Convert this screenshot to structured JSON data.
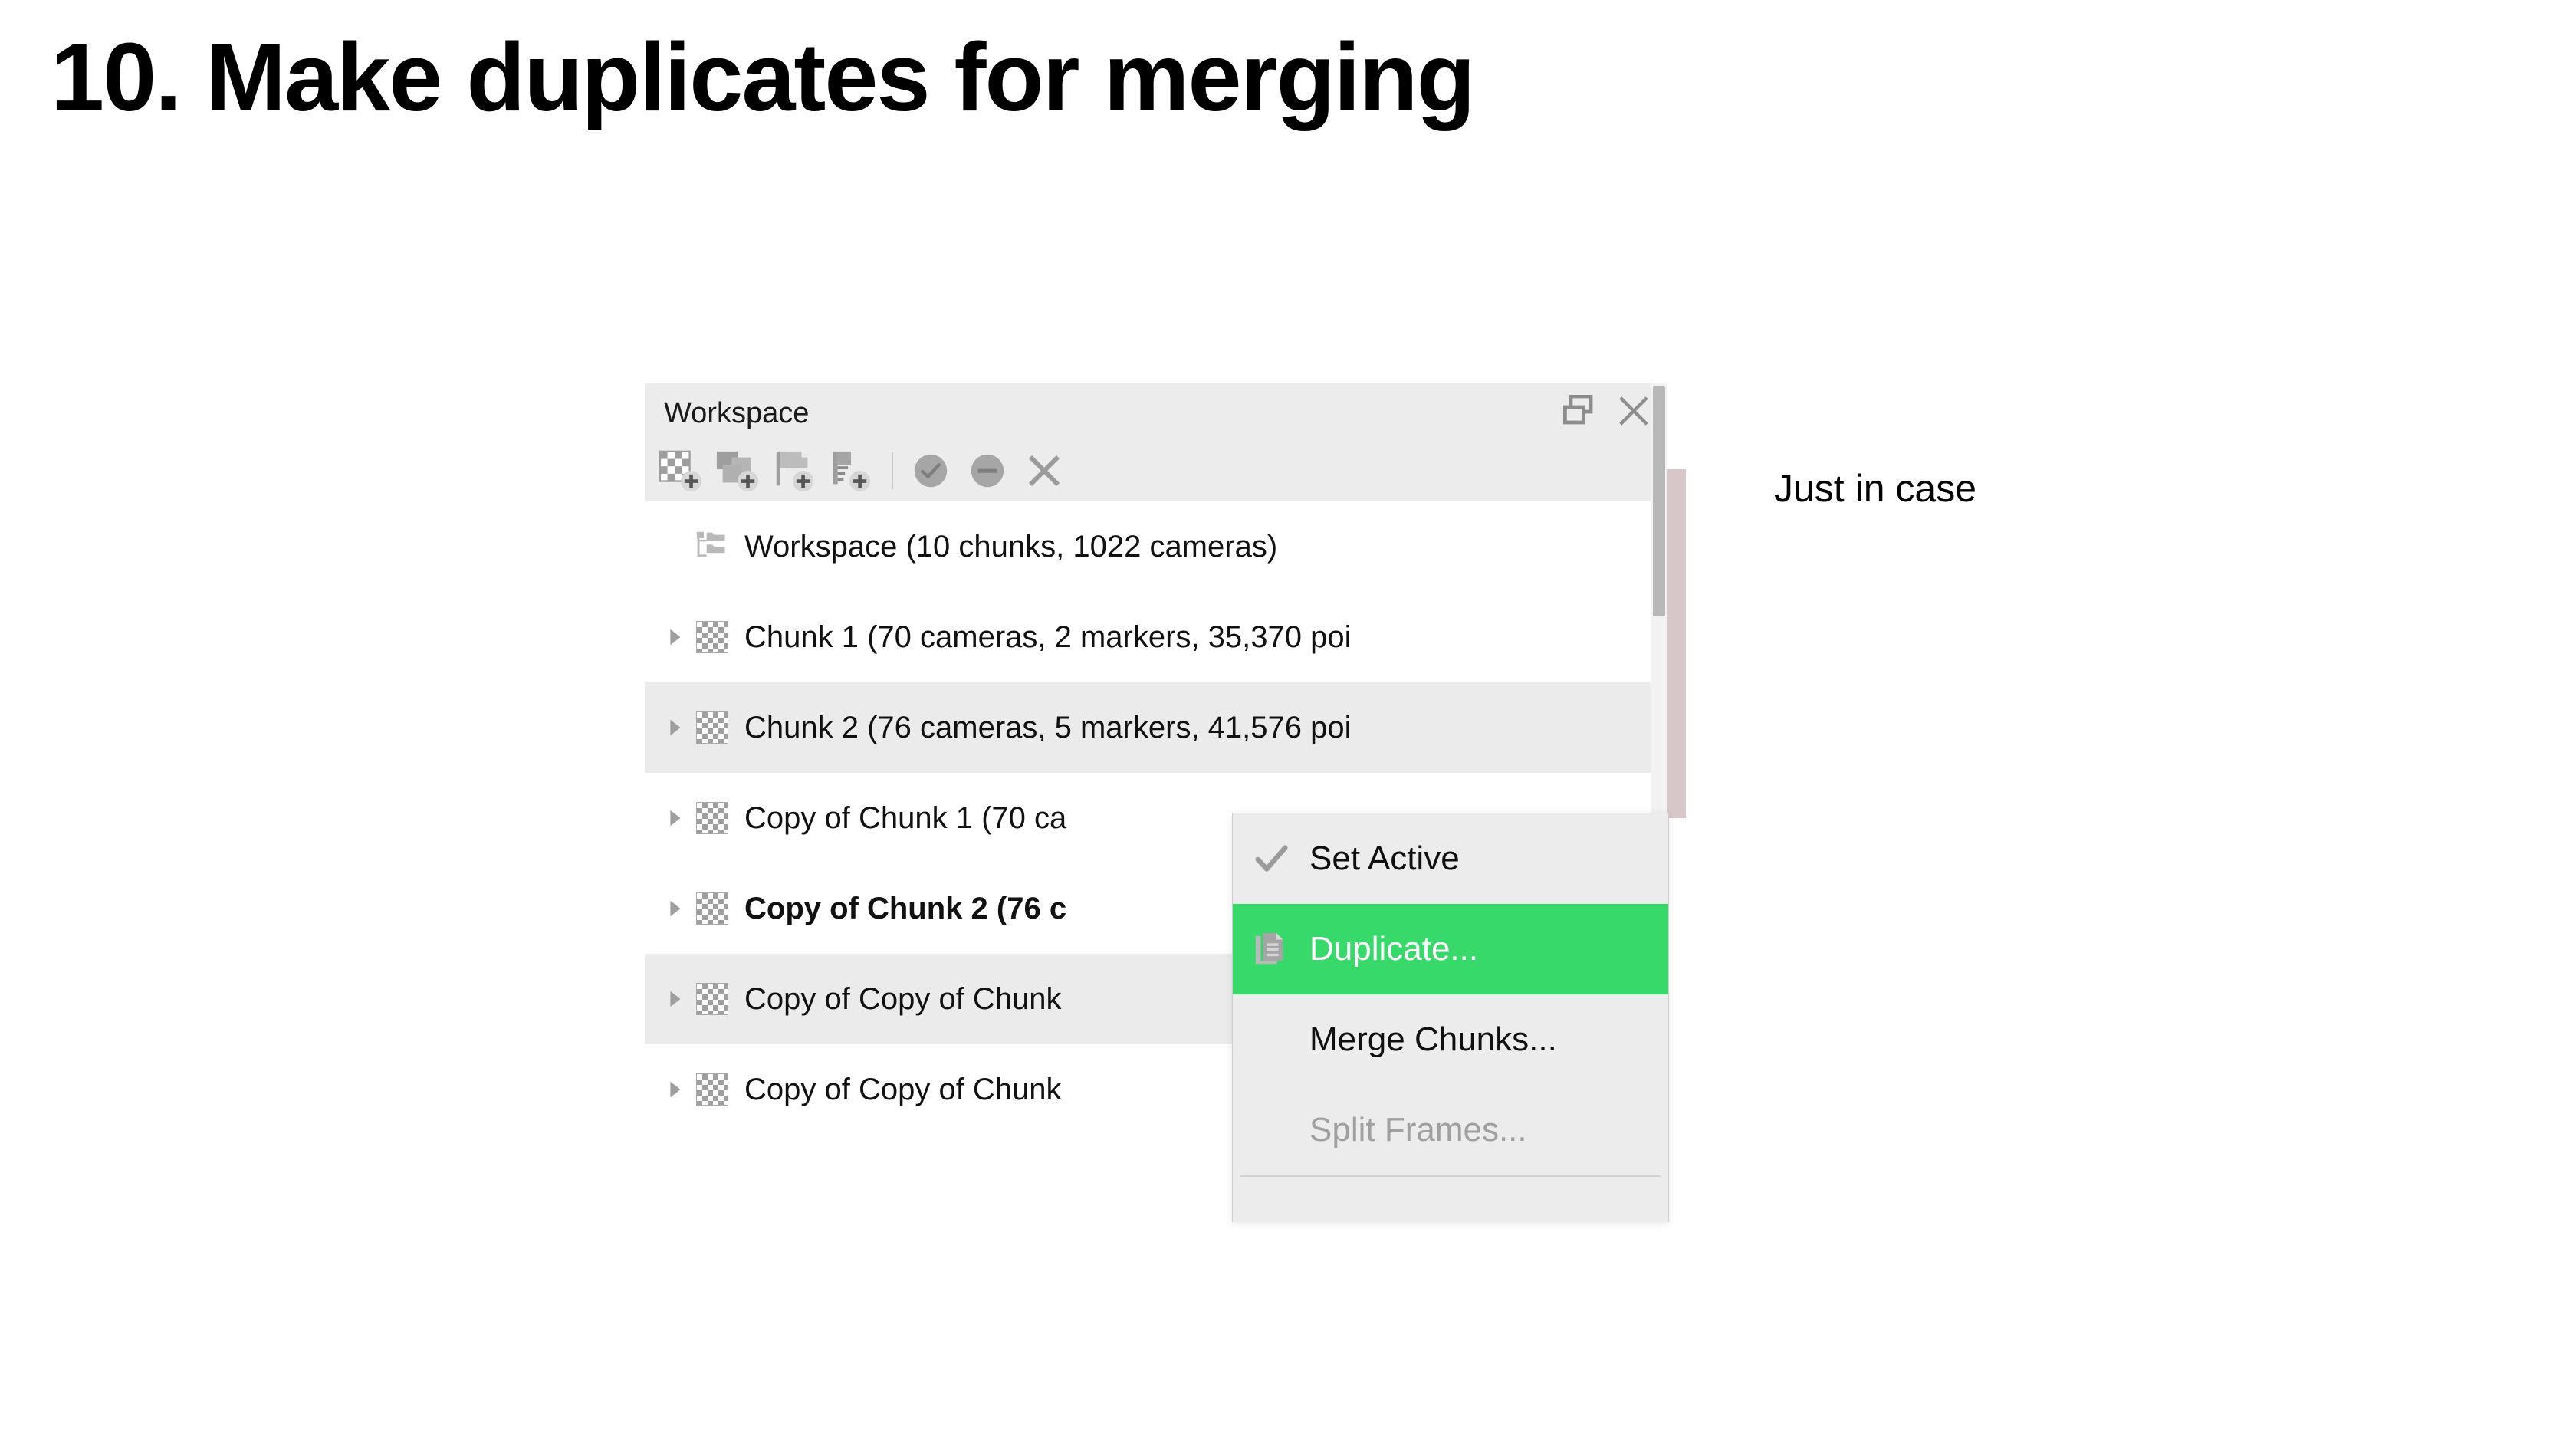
{
  "slide": {
    "title": "10. Make duplicates for merging",
    "annotation": "Just in case"
  },
  "panel": {
    "title": "Workspace",
    "header_buttons": [
      {
        "name": "float-icon",
        "tooltip": "Float"
      },
      {
        "name": "close-icon",
        "tooltip": "Close"
      }
    ],
    "toolbar": [
      {
        "name": "add-chunk-icon",
        "tooltip": "Add Chunk"
      },
      {
        "name": "add-photos-icon",
        "tooltip": "Add Photos"
      },
      {
        "name": "add-marker-icon",
        "tooltip": "Add Marker"
      },
      {
        "name": "add-scalebar-icon",
        "tooltip": "Add Scale Bar"
      },
      {
        "name": "enable-icon",
        "tooltip": "Enable"
      },
      {
        "name": "disable-icon",
        "tooltip": "Disable"
      },
      {
        "name": "remove-icon",
        "tooltip": "Remove"
      }
    ],
    "tree": [
      {
        "label": "Workspace (10 chunks, 1022 cameras)",
        "icon": "workspace-icon",
        "twisty": false,
        "selected": false,
        "bold": false,
        "root": true
      },
      {
        "label": "Chunk 1 (70 cameras, 2 markers, 35,370 poi",
        "icon": "chunk-icon",
        "twisty": true,
        "selected": false,
        "bold": false,
        "root": false
      },
      {
        "label": "Chunk 2 (76 cameras, 5 markers, 41,576 poi",
        "icon": "chunk-icon",
        "twisty": true,
        "selected": true,
        "bold": false,
        "root": false
      },
      {
        "label": "Copy of Chunk 1 (70 ca",
        "icon": "chunk-icon",
        "twisty": true,
        "selected": false,
        "bold": false,
        "root": false
      },
      {
        "label": "Copy of Chunk 2 (76 c",
        "icon": "chunk-icon",
        "twisty": true,
        "selected": false,
        "bold": true,
        "root": false
      },
      {
        "label": "Copy of Copy of Chunk",
        "icon": "chunk-icon",
        "twisty": true,
        "selected": true,
        "bold": false,
        "root": false
      },
      {
        "label": "Copy of Copy of Chunk",
        "icon": "chunk-icon",
        "twisty": true,
        "selected": false,
        "bold": false,
        "root": false
      }
    ],
    "scrollbar": {
      "name": "vertical-scrollbar"
    }
  },
  "context_menu": {
    "items": [
      {
        "label": "Set Active",
        "icon": "check-icon",
        "state": "normal"
      },
      {
        "label": "Duplicate...",
        "icon": "duplicate-icon",
        "state": "highlight"
      },
      {
        "label": "Merge Chunks...",
        "icon": "",
        "state": "normal"
      },
      {
        "label": "Split Frames...",
        "icon": "",
        "state": "disabled"
      }
    ]
  },
  "colors": {
    "highlight_green": "#36d96a",
    "panel_chrome": "#ececec",
    "row_selected": "#ebebeb",
    "icon_gray": "#a0a0a0"
  }
}
